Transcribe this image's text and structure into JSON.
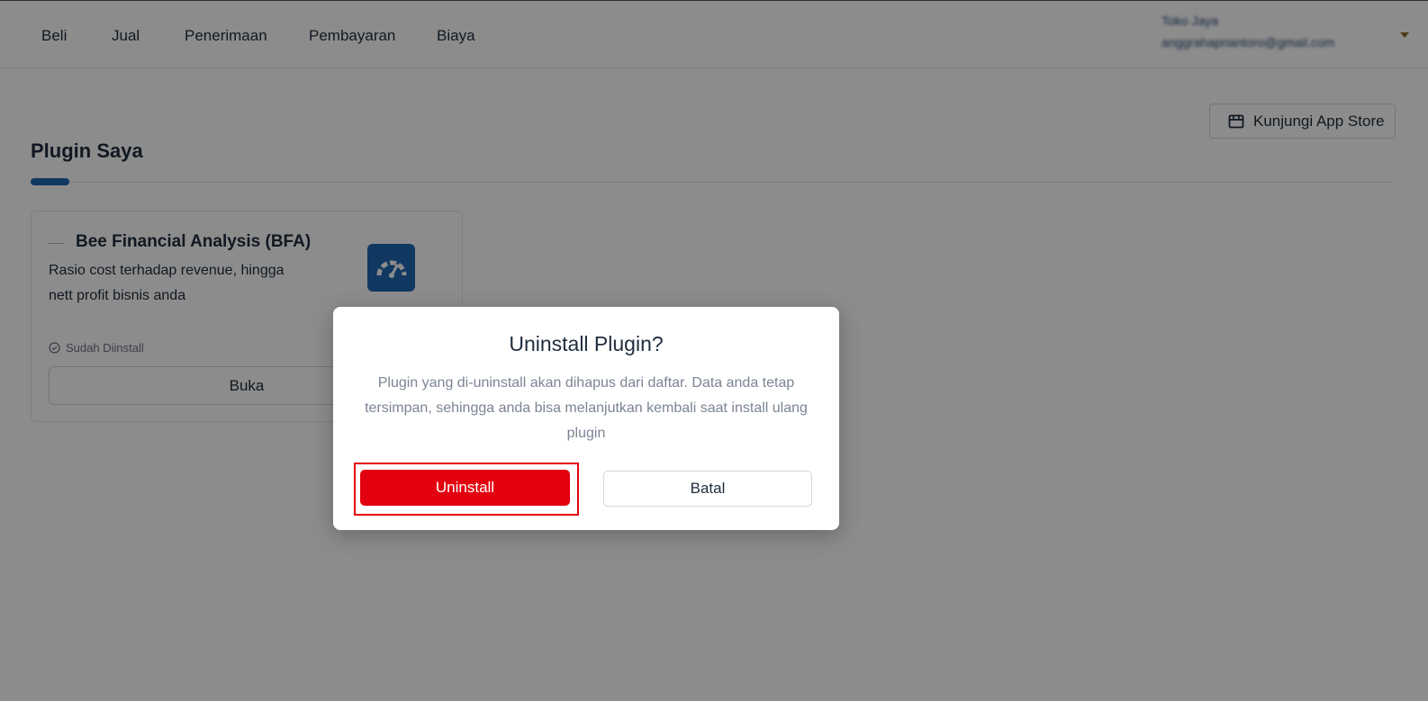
{
  "nav": {
    "items": [
      {
        "label": "Beli"
      },
      {
        "label": "Jual"
      },
      {
        "label": "Penerimaan"
      },
      {
        "label": "Pembayaran"
      },
      {
        "label": "Biaya"
      }
    ],
    "user": {
      "name": "Toko Jaya",
      "email": "anggrahapriantoro@gmail.com"
    }
  },
  "page": {
    "title": "Plugin Saya",
    "app_store_button": "Kunjungi App Store"
  },
  "plugin_card": {
    "title": "Bee Financial Analysis (BFA)",
    "description": "Rasio cost terhadap revenue, hingga nett profit bisnis anda",
    "status": "Sudah Diinstall",
    "open_button": "Buka",
    "icon": "speedometer-icon"
  },
  "modal": {
    "title": "Uninstall Plugin?",
    "body": "Plugin yang di-uninstall akan dihapus dari daftar. Data anda tetap tersimpan, sehingga anda bisa melanjutkan kembali saat install ulang plugin",
    "confirm_button": "Uninstall",
    "cancel_button": "Batal"
  },
  "colors": {
    "primary": "#1f67b1",
    "danger": "#e3000f",
    "overlay": "rgba(0,0,0,0.45)"
  }
}
